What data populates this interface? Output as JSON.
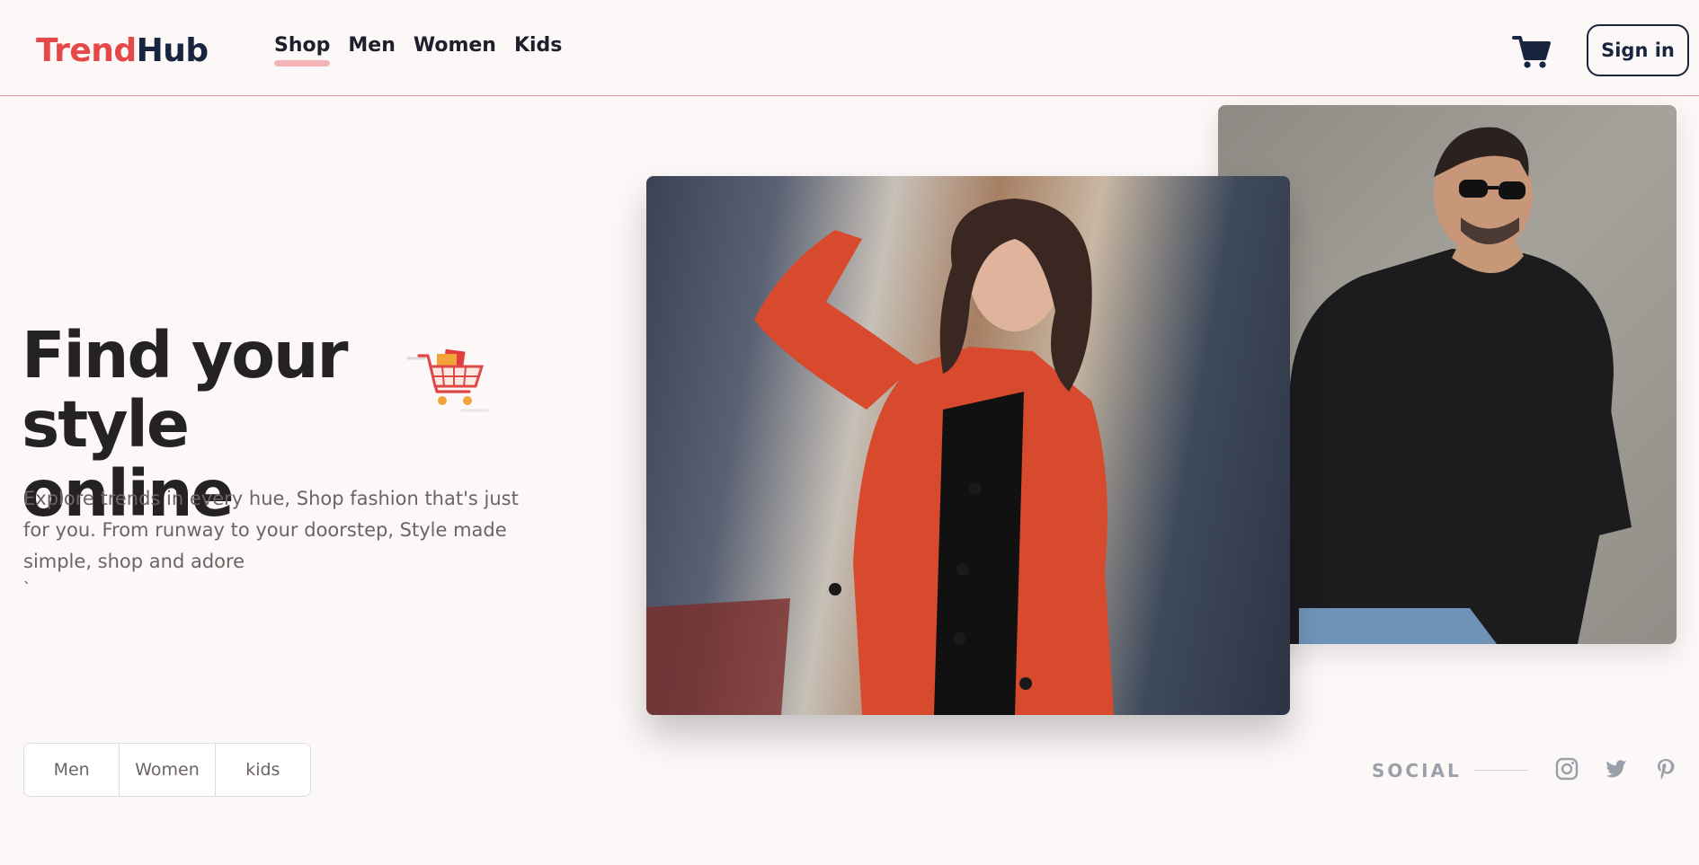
{
  "header": {
    "logo_part1": "Trend",
    "logo_part2": "Hub",
    "nav": [
      "Shop",
      "Men",
      "Women",
      "Kids"
    ],
    "active_nav": "Shop",
    "cart_icon": "cart-icon",
    "signin_label": "Sign in"
  },
  "hero": {
    "title_line1": "Find your",
    "title_line2": "style online",
    "illustration_icon": "shopping-cart-illustration",
    "description": "Explore trends in every hue, Shop fashion that's just for you. From runway to your doorstep, Style made simple, shop and adore",
    "stray_character": "`",
    "categories": [
      "Men",
      "Women",
      "kids"
    ]
  },
  "photos": {
    "woman_icon": "woman-red-coat-photo",
    "man_icon": "man-black-tshirt-photo"
  },
  "social": {
    "label": "SOCIAL",
    "icons": [
      "instagram-icon",
      "twitter-icon",
      "pinterest-icon"
    ]
  },
  "colors": {
    "accent": "#e54848",
    "navy": "#18253f",
    "background": "#fdf8f8",
    "nav_underline": "#f6b3b5",
    "muted_text": "#6c6363",
    "social_gray": "#9aa0aa"
  }
}
